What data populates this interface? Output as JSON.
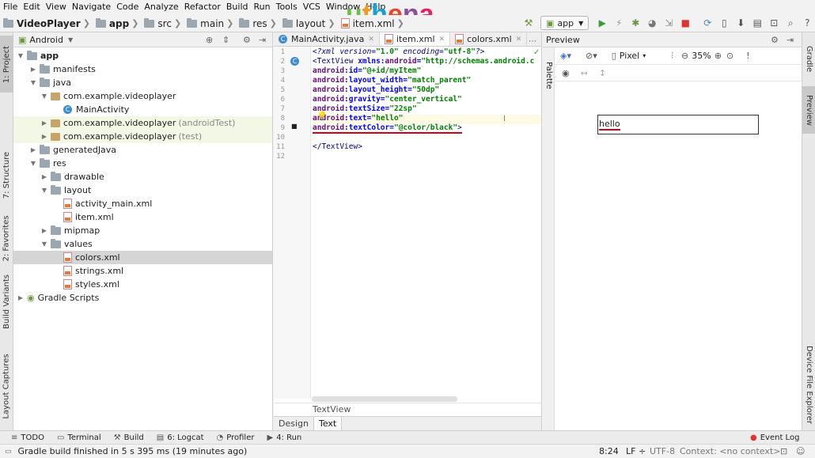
{
  "menu": [
    "File",
    "Edit",
    "View",
    "Navigate",
    "Code",
    "Analyze",
    "Refactor",
    "Build",
    "Run",
    "Tools",
    "VCS",
    "Window",
    "Help"
  ],
  "logo": {
    "text_parts": [
      "u",
      "t",
      "h",
      "e",
      "n",
      "a"
    ]
  },
  "breadcrumb": [
    "VideoPlayer",
    "app",
    "src",
    "main",
    "res",
    "layout",
    "item.xml"
  ],
  "run_config": "app",
  "left_tabs": [
    "1: Project",
    "7: Structure",
    "2: Favorites",
    "Build Variants",
    "Layout Captures"
  ],
  "right_tabs": [
    "Gradle",
    "Preview",
    "Device File Explorer"
  ],
  "project": {
    "view_mode": "Android",
    "tree": [
      {
        "label": "app",
        "extra": "",
        "level": 0
      },
      {
        "label": "manifests",
        "extra": "",
        "level": 1
      },
      {
        "label": "java",
        "extra": "",
        "level": 1
      },
      {
        "label": "com.example.videoplayer",
        "extra": "",
        "level": 2
      },
      {
        "label": "MainActivity",
        "extra": "",
        "level": 3
      },
      {
        "label": "com.example.videoplayer",
        "extra": "(androidTest)",
        "level": 2
      },
      {
        "label": "com.example.videoplayer",
        "extra": "(test)",
        "level": 2
      },
      {
        "label": "generatedJava",
        "extra": "",
        "level": 1
      },
      {
        "label": "res",
        "extra": "",
        "level": 1
      },
      {
        "label": "drawable",
        "extra": "",
        "level": 2
      },
      {
        "label": "layout",
        "extra": "",
        "level": 2
      },
      {
        "label": "activity_main.xml",
        "extra": "",
        "level": 3
      },
      {
        "label": "item.xml",
        "extra": "",
        "level": 3
      },
      {
        "label": "mipmap",
        "extra": "",
        "level": 2
      },
      {
        "label": "values",
        "extra": "",
        "level": 2
      },
      {
        "label": "colors.xml",
        "extra": "",
        "level": 3
      },
      {
        "label": "strings.xml",
        "extra": "",
        "level": 3
      },
      {
        "label": "styles.xml",
        "extra": "",
        "level": 3
      },
      {
        "label": "Gradle Scripts",
        "extra": "",
        "level": 0
      }
    ]
  },
  "editor": {
    "tabs": [
      "MainActivity.java",
      "item.xml",
      "colors.xml"
    ],
    "line_numbers": [
      "1",
      "2",
      "3",
      "4",
      "5",
      "6",
      "7",
      "8",
      "9",
      "10",
      "11",
      "12"
    ],
    "lines": [
      {
        "p": [
          "<?xml version=",
          "\"1.0\"",
          " encoding=",
          "\"utf-8\"",
          "?>"
        ]
      },
      {
        "p": [
          "<TextView ",
          "xmlns:",
          "android",
          "=",
          "\"http://schemas.android.c"
        ]
      },
      {
        "p": [
          "    android",
          ":id=",
          "\"@+id/myItem\""
        ]
      },
      {
        "p": [
          "    android",
          ":layout_width=",
          "\"match_parent\""
        ]
      },
      {
        "p": [
          "    android",
          ":layout_height=",
          "\"50dp\""
        ]
      },
      {
        "p": [
          "    android",
          ":gravity=",
          "\"center_vertical\""
        ]
      },
      {
        "p": [
          "    android",
          ":textSize=",
          "\"22sp\""
        ]
      },
      {
        "p": [
          "    android",
          ":text=",
          "\"hello\""
        ]
      },
      {
        "p": [
          "    android",
          ":textColor=",
          "\"@color/black\"",
          ">"
        ]
      },
      {
        "p": [
          ""
        ]
      },
      {
        "p": [
          "</TextView>"
        ]
      }
    ],
    "breadcrumb": "TextView",
    "mode_tabs": [
      "Design",
      "Text"
    ]
  },
  "preview": {
    "title": "Preview",
    "palette_label": "Palette",
    "device": "Pixel",
    "zoom": "35%",
    "rendered_text": "hello"
  },
  "bottom_tools": [
    {
      "icon": "≡",
      "label": "TODO"
    },
    {
      "icon": "▭",
      "label": "Terminal"
    },
    {
      "icon": "⚒",
      "label": "Build"
    },
    {
      "icon": "",
      "label": "6: Logcat"
    },
    {
      "icon": "◔",
      "label": "Profiler"
    },
    {
      "icon": "▶",
      "label": "4: Run"
    }
  ],
  "event_log": "Event Log",
  "status": {
    "message": "Gradle build finished in 5 s 395 ms (19 minutes ago)",
    "position": "8:24",
    "line_sep": "LF ÷",
    "encoding": "UTF-8",
    "context": "Context: <no context>"
  },
  "colors": {
    "accent_tab": "#c9c9c9",
    "error_underline": "#d0021b"
  }
}
